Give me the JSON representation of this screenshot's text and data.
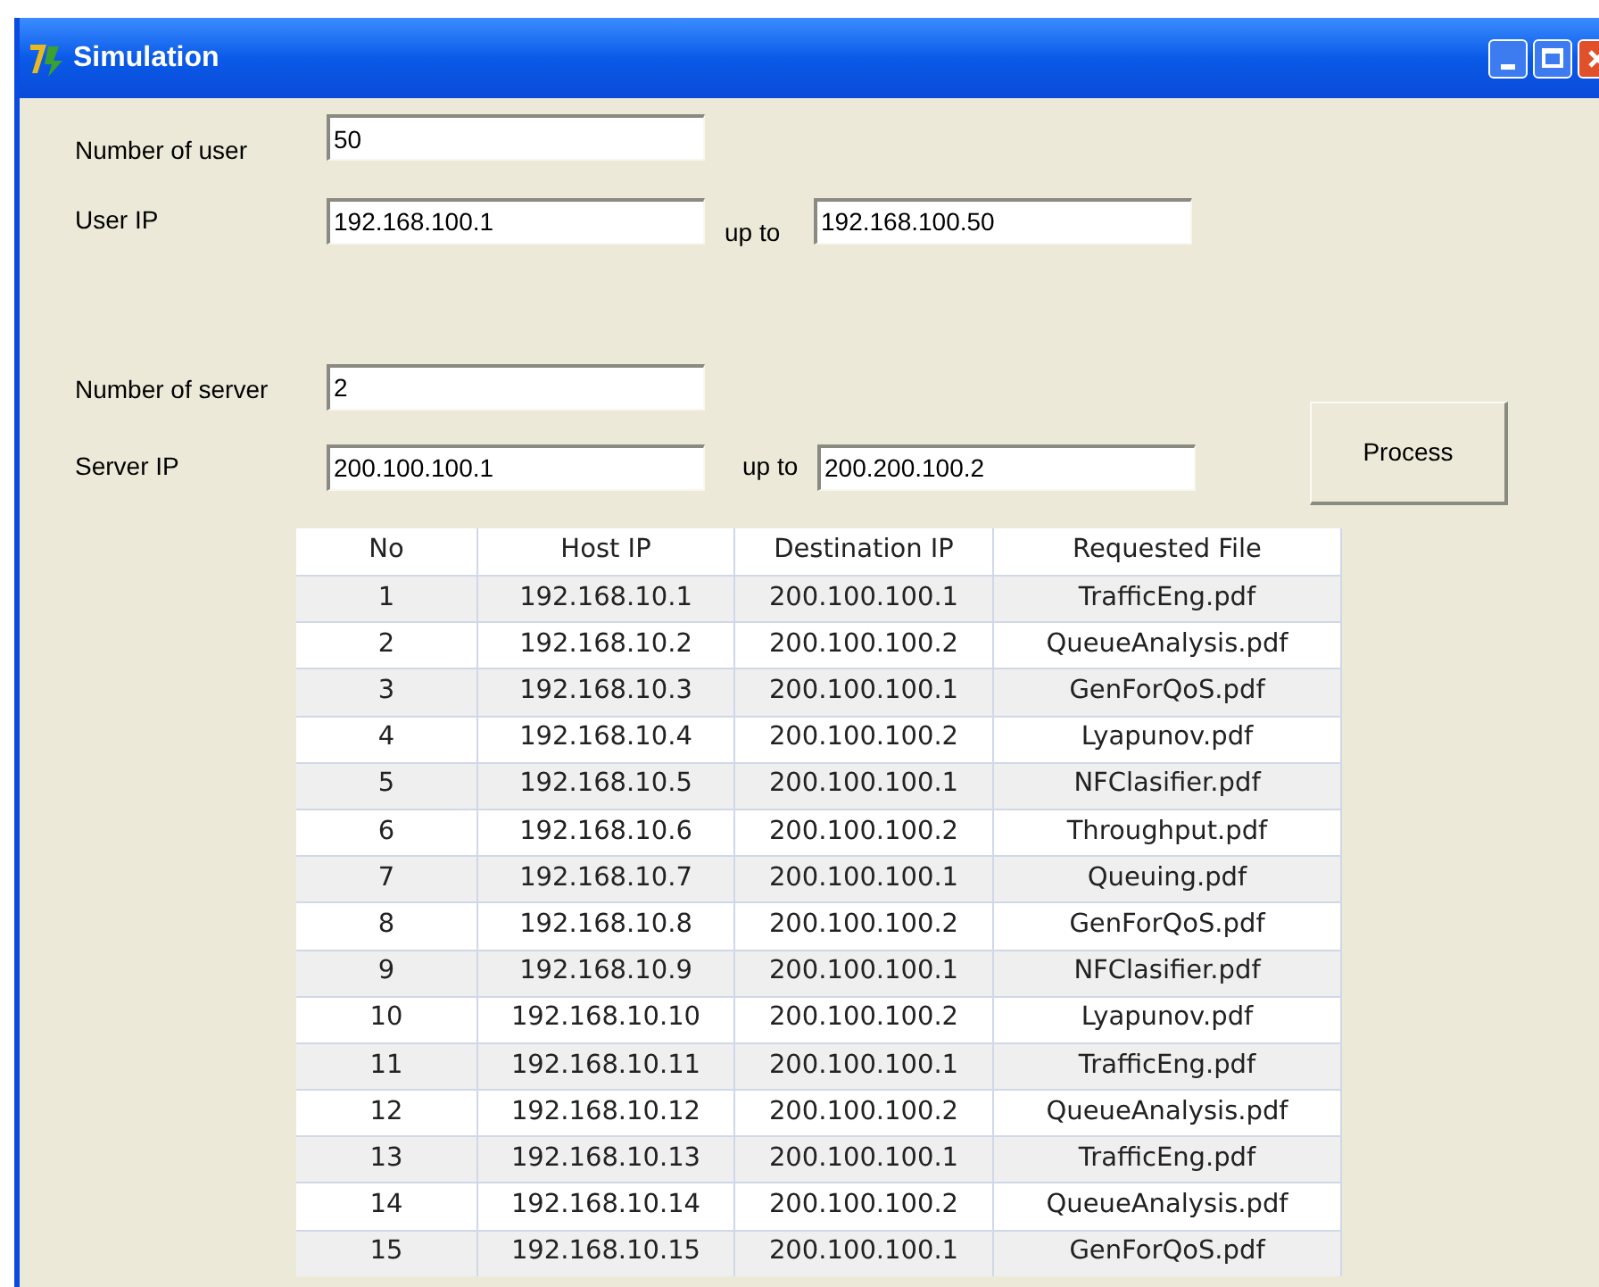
{
  "window": {
    "title": "Simulation"
  },
  "users": {
    "count_label": "Number of user",
    "count": "50",
    "ip_label": "User IP",
    "ip_from": "192.168.100.1",
    "up_to": "up to",
    "ip_to": "192.168.100.50"
  },
  "servers": {
    "count_label": "Number of server",
    "count": "2",
    "ip_label": "Server IP",
    "ip_from": "200.100.100.1",
    "up_to": "up to",
    "ip_to": "200.200.100.2"
  },
  "process_button": "Process",
  "table": {
    "columns": [
      "No",
      "Host IP",
      "Destination IP",
      "Requested File"
    ],
    "rows": [
      [
        "1",
        "192.168.10.1",
        "200.100.100.1",
        "TrafficEng.pdf"
      ],
      [
        "2",
        "192.168.10.2",
        "200.100.100.2",
        "QueueAnalysis.pdf"
      ],
      [
        "3",
        "192.168.10.3",
        "200.100.100.1",
        "GenForQoS.pdf"
      ],
      [
        "4",
        "192.168.10.4",
        "200.100.100.2",
        "Lyapunov.pdf"
      ],
      [
        "5",
        "192.168.10.5",
        "200.100.100.1",
        "NFClasifier.pdf"
      ],
      [
        "6",
        "192.168.10.6",
        "200.100.100.2",
        "Throughput.pdf"
      ],
      [
        "7",
        "192.168.10.7",
        "200.100.100.1",
        "Queuing.pdf"
      ],
      [
        "8",
        "192.168.10.8",
        "200.100.100.2",
        "GenForQoS.pdf"
      ],
      [
        "9",
        "192.168.10.9",
        "200.100.100.1",
        "NFClasifier.pdf"
      ],
      [
        "10",
        "192.168.10.10",
        "200.100.100.2",
        "Lyapunov.pdf"
      ],
      [
        "11",
        "192.168.10.11",
        "200.100.100.1",
        "TrafficEng.pdf"
      ],
      [
        "12",
        "192.168.10.12",
        "200.100.100.2",
        "QueueAnalysis.pdf"
      ],
      [
        "13",
        "192.168.10.13",
        "200.100.100.1",
        "TrafficEng.pdf"
      ],
      [
        "14",
        "192.168.10.14",
        "200.100.100.2",
        "QueueAnalysis.pdf"
      ],
      [
        "15",
        "192.168.10.15",
        "200.100.100.1",
        "GenForQoS.pdf"
      ]
    ]
  }
}
